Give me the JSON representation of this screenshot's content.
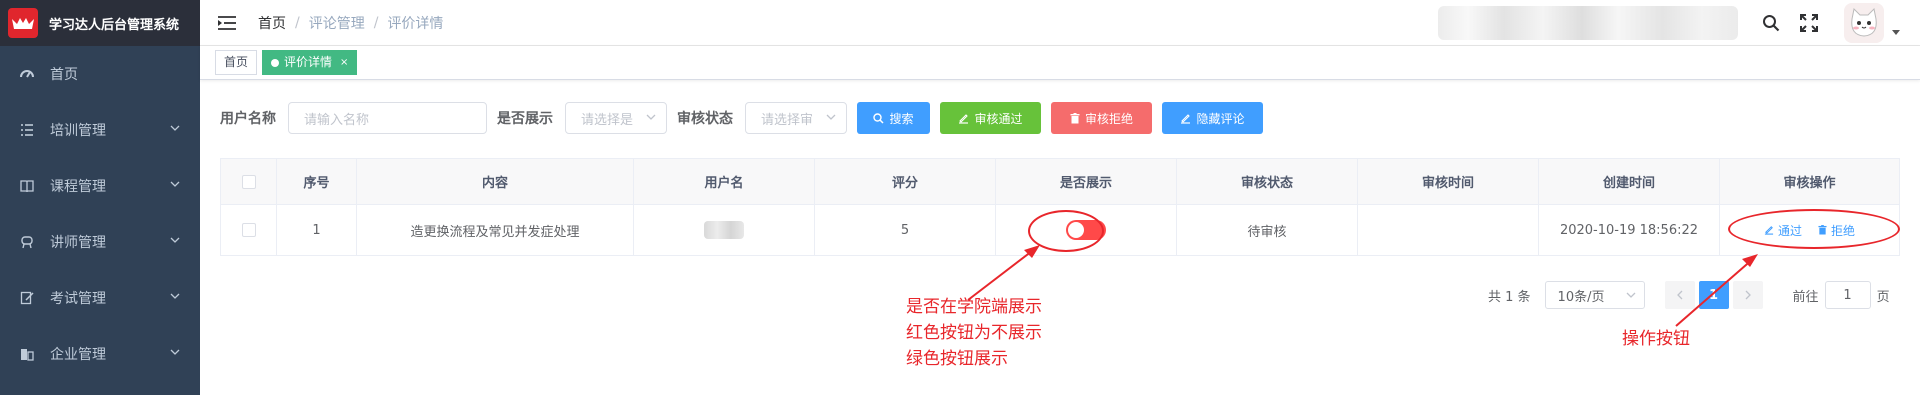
{
  "app": {
    "title": "学习达人后台管理系统"
  },
  "sidebar": {
    "items": [
      {
        "label": "首页",
        "icon": "dashboard-icon",
        "has_children": false
      },
      {
        "label": "培训管理",
        "icon": "list-icon",
        "has_children": true
      },
      {
        "label": "课程管理",
        "icon": "book-icon",
        "has_children": true
      },
      {
        "label": "讲师管理",
        "icon": "teacher-icon",
        "has_children": true
      },
      {
        "label": "考试管理",
        "icon": "exam-icon",
        "has_children": true
      },
      {
        "label": "企业管理",
        "icon": "company-icon",
        "has_children": true
      }
    ]
  },
  "header": {
    "breadcrumb": [
      "首页",
      "评论管理",
      "评价详情"
    ]
  },
  "tags": {
    "home": "首页",
    "active": "评价详情",
    "close": "×"
  },
  "filters": {
    "username_label": "用户名称",
    "username_placeholder": "请输入名称",
    "show_label": "是否展示",
    "show_placeholder": "请选择是",
    "status_label": "审核状态",
    "status_placeholder": "请选择审",
    "buttons": {
      "search": "搜索",
      "approve": "审核通过",
      "reject": "审核拒绝",
      "hide": "隐藏评论"
    }
  },
  "table": {
    "headers": [
      "序号",
      "内容",
      "用户名",
      "评分",
      "是否展示",
      "审核状态",
      "审核时间",
      "创建时间",
      "审核操作"
    ],
    "rows": [
      {
        "index": "1",
        "content": "造更换流程及常见并发症处理",
        "score": "5",
        "show": false,
        "status": "待审核",
        "audit_time": "",
        "created": "2020-10-19 18:56:22",
        "actions": {
          "pass": "通过",
          "reject": "拒绝"
        }
      }
    ]
  },
  "pagination": {
    "total": "共 1 条",
    "page_size": "10条/页",
    "current": "1",
    "goto_label": "前往",
    "goto_value": "1",
    "page_suffix": "页"
  },
  "annotations": {
    "switch_note": [
      "是否在学院端展示",
      "红色按钮为不展示",
      "绿色按钮展示"
    ],
    "actions_note": "操作按钮"
  },
  "colors": {
    "sidebar_bg": "#304156",
    "primary": "#409eff",
    "success": "#67c23a",
    "danger": "#f56c6c",
    "tag_active": "#42b983",
    "switch_off": "#ff4949",
    "annotation": "#e8262b"
  }
}
